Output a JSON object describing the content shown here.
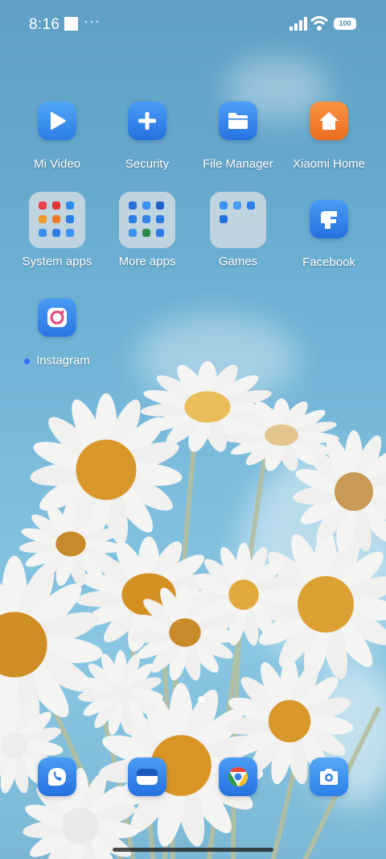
{
  "status_bar": {
    "time": "8:16",
    "more": "···",
    "battery": "100"
  },
  "apps_row1": [
    {
      "label": "Mi Video",
      "icon": "play-icon",
      "color": "#3d8ff0"
    },
    {
      "label": "Security",
      "icon": "plus-icon",
      "color": "#2f7de8"
    },
    {
      "label": "File Manager",
      "icon": "folder-icon",
      "color": "#2e7fe6"
    },
    {
      "label": "Xiaomi Home",
      "icon": "home-icon",
      "color": "#f07c2a"
    }
  ],
  "apps_row2": [
    {
      "label": "System apps",
      "icon": "folder-icon"
    },
    {
      "label": "More apps",
      "icon": "folder-icon"
    },
    {
      "label": "Games",
      "icon": "folder-icon"
    },
    {
      "label": "Facebook",
      "icon": "facebook-icon",
      "color": "#2c77ea"
    }
  ],
  "apps_row3": [
    {
      "label": "Instagram",
      "icon": "instagram-icon",
      "color": "#3b86ec",
      "new_badge": true
    }
  ],
  "dock": [
    {
      "icon": "phone-icon",
      "color": "#2b7eea"
    },
    {
      "icon": "messages-icon",
      "color": "#2b7eea"
    },
    {
      "icon": "chrome-icon",
      "color": "#2b7eea"
    },
    {
      "icon": "camera-icon",
      "color": "#3592ef"
    }
  ]
}
